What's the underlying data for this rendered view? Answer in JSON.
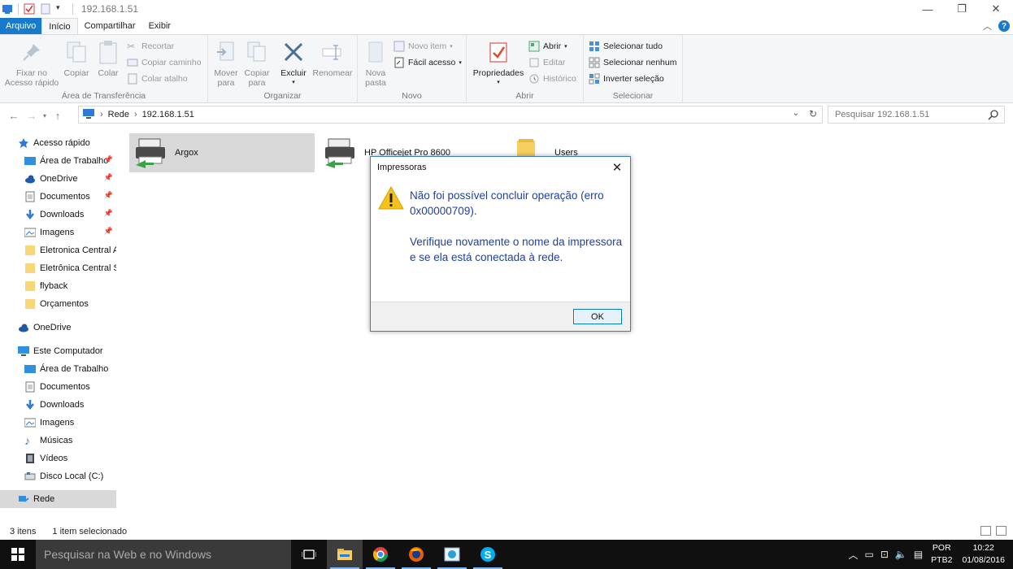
{
  "window": {
    "title": "192.168.1.51",
    "controls": [
      "minimize",
      "maximize",
      "close"
    ]
  },
  "ribbon_tabs": [
    {
      "label": "Arquivo"
    },
    {
      "label": "Início"
    },
    {
      "label": "Compartilhar"
    },
    {
      "label": "Exibir"
    }
  ],
  "ribbon": {
    "clipboard": {
      "label": "Área de Transferência",
      "pin": "Fixar no\nAcesso rápido",
      "copy": "Copiar",
      "paste": "Colar",
      "cut": "Recortar",
      "copy_path": "Copiar caminho",
      "paste_shortcut": "Colar atalho"
    },
    "organize": {
      "label": "Organizar",
      "move": "Mover\npara",
      "copy_to": "Copiar\npara",
      "delete": "Excluir",
      "rename": "Renomear"
    },
    "new": {
      "label": "Novo",
      "new_folder": "Nova\npasta",
      "new_item": "Novo item",
      "easy_access": "Fácil acesso"
    },
    "open": {
      "label": "Abrir",
      "properties": "Propriedades",
      "open": "Abrir",
      "edit": "Editar",
      "history": "Histórico"
    },
    "select": {
      "label": "Selecionar",
      "select_all": "Selecionar tudo",
      "select_none": "Selecionar nenhum",
      "invert": "Inverter seleção"
    }
  },
  "address": {
    "crumbs": [
      "Rede",
      "192.168.1.51"
    ],
    "search_placeholder": "Pesquisar 192.168.1.51"
  },
  "nav_pane": {
    "quick_access": "Acesso rápido",
    "quick_items": [
      {
        "label": "Área de Trabalho",
        "pinned": true
      },
      {
        "label": "OneDrive",
        "pinned": true
      },
      {
        "label": "Documentos",
        "pinned": true
      },
      {
        "label": "Downloads",
        "pinned": true
      },
      {
        "label": "Imagens",
        "pinned": true
      },
      {
        "label": "Eletronica Central A"
      },
      {
        "label": "Eletrônica Central S"
      },
      {
        "label": "flyback"
      },
      {
        "label": "Orçamentos"
      }
    ],
    "onedrive": "OneDrive",
    "this_pc": "Este Computador",
    "pc_items": [
      {
        "label": "Área de Trabalho"
      },
      {
        "label": "Documentos"
      },
      {
        "label": "Downloads"
      },
      {
        "label": "Imagens"
      },
      {
        "label": "Músicas"
      },
      {
        "label": "Vídeos"
      },
      {
        "label": "Disco Local (C:)"
      }
    ],
    "network": "Rede"
  },
  "content_items": [
    {
      "label": "Argox",
      "icon": "printer-icon",
      "selected": true
    },
    {
      "label": "HP Officejet Pro 8600",
      "icon": "printer-icon"
    },
    {
      "label": "Users",
      "icon": "folder-icon"
    }
  ],
  "status": {
    "count": "3 itens",
    "selection": "1 item selecionado"
  },
  "taskbar": {
    "search_placeholder": "Pesquisar na Web e no Windows",
    "lang_top": "POR",
    "lang_bottom": "PTB2",
    "time": "10:22",
    "date": "01/08/2016"
  },
  "dialog": {
    "title": "Impressoras",
    "message_1": "Não foi possível concluir operação (erro 0x00000709).",
    "message_2": "Verifique novamente o nome da impressora e se ela está conectada à rede.",
    "ok_label": "OK"
  },
  "colors": {
    "accent": "#1979ca",
    "dialog_text": "#1f3fa0",
    "taskbar": "#101010"
  }
}
